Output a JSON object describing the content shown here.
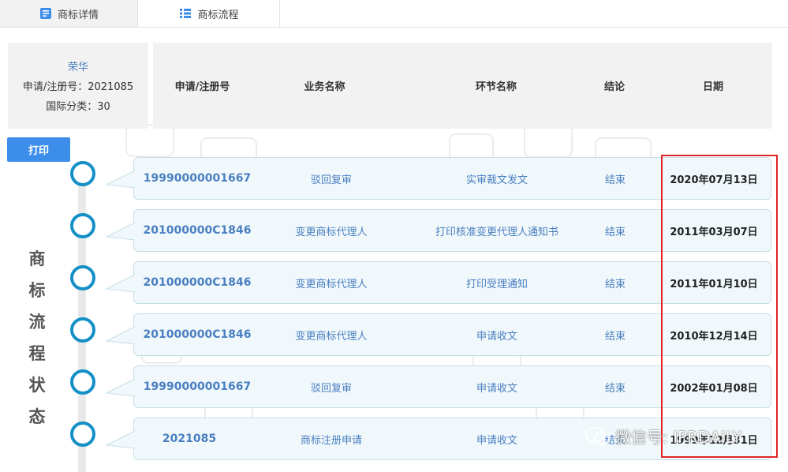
{
  "tabs": [
    {
      "label": "商标详情",
      "icon": "document-icon",
      "active": true
    },
    {
      "label": "商标流程",
      "icon": "list-icon",
      "active": false
    }
  ],
  "info": {
    "owner": "荣华",
    "reg_number": "申请/注册号：2021085",
    "intl_class": "国际分类：30"
  },
  "table_headers": [
    "申请/注册号",
    "业务名称",
    "环节名称",
    "结论",
    "日期"
  ],
  "print_label": "打印",
  "side_label": [
    "商",
    "标",
    "流",
    "程",
    "状",
    "态"
  ],
  "rows": [
    {
      "reg": "19990000001667",
      "business": "驳回复审",
      "step": "实审裁文发文",
      "result": "结束",
      "date": "2020年07月13日"
    },
    {
      "reg": "201000000C1846",
      "business": "变更商标代理人",
      "step": "打印核准变更代理人通知书",
      "result": "结束",
      "date": "2011年03月07日"
    },
    {
      "reg": "201000000C1846",
      "business": "变更商标代理人",
      "step": "打印受理通知",
      "result": "结束",
      "date": "2011年01月10日"
    },
    {
      "reg": "201000000C1846",
      "business": "变更商标代理人",
      "step": "申请收文",
      "result": "结束",
      "date": "2010年12月14日"
    },
    {
      "reg": "19990000001667",
      "business": "驳回复审",
      "step": "申请收文",
      "result": "结束",
      "date": "2002年01月08日"
    },
    {
      "reg": "2021085",
      "business": "商标注册申请",
      "step": "申请收文",
      "result": "结束",
      "date": "1999年12月31日"
    }
  ],
  "watermark": "微信号: IPRDAILY",
  "colors": {
    "accent": "#3d8eea",
    "timeline": "#1590c6",
    "link": "#4a7fc1",
    "highlight": "#e02626"
  }
}
